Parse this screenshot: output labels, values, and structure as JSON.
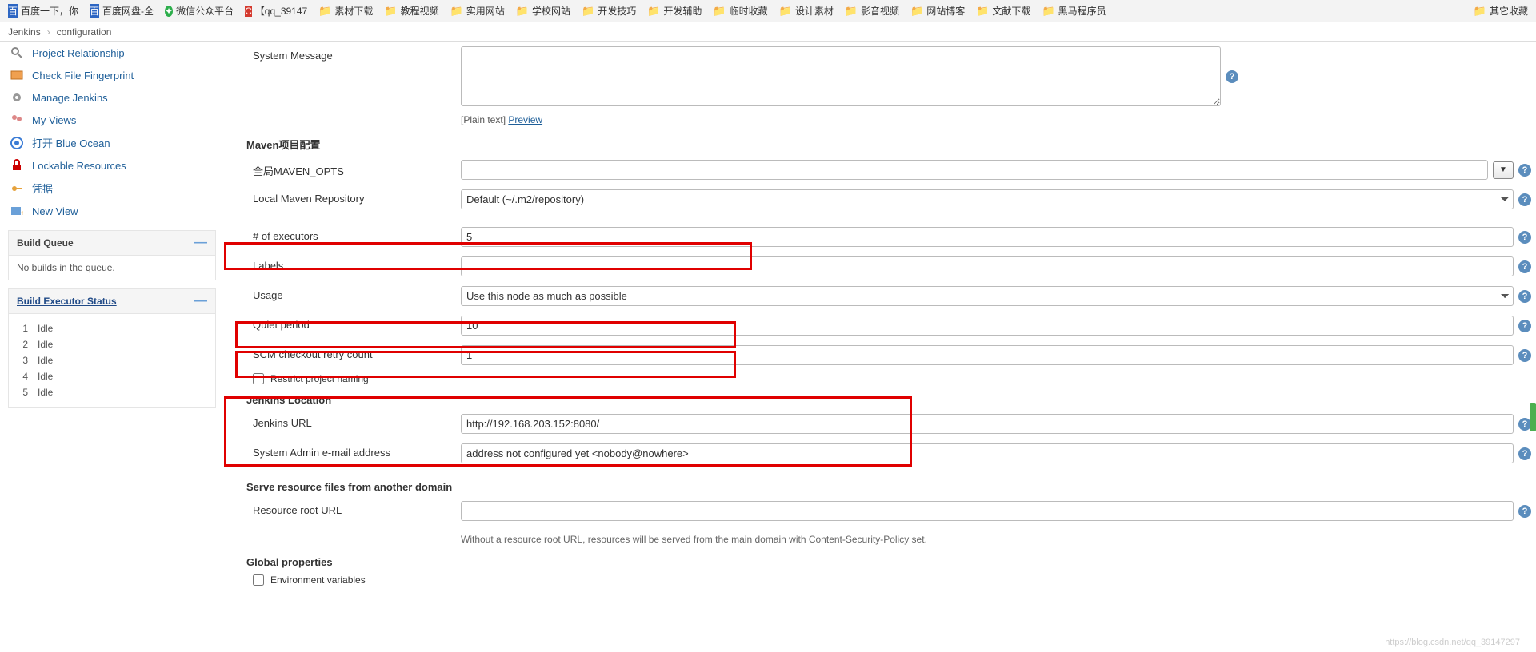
{
  "bookmarks": [
    {
      "icon": "baidu",
      "label": "百度一下，你",
      "color": "#2d66c3"
    },
    {
      "icon": "baidu",
      "label": "百度网盘-全",
      "color": "#2d66c3"
    },
    {
      "icon": "wechat",
      "label": "微信公众平台",
      "color": "#2cae4b"
    },
    {
      "icon": "csdn",
      "label": "【qq_39147",
      "color": "#d43a2f"
    },
    {
      "icon": "folder",
      "label": "素材下载"
    },
    {
      "icon": "folder",
      "label": "教程视频"
    },
    {
      "icon": "folder",
      "label": "实用网站"
    },
    {
      "icon": "folder",
      "label": "学校网站"
    },
    {
      "icon": "folder",
      "label": "开发技巧"
    },
    {
      "icon": "folder",
      "label": "开发辅助"
    },
    {
      "icon": "folder",
      "label": "临时收藏"
    },
    {
      "icon": "folder",
      "label": "设计素材"
    },
    {
      "icon": "folder",
      "label": "影音视频"
    },
    {
      "icon": "folder",
      "label": "网站博客"
    },
    {
      "icon": "folder",
      "label": "文献下载"
    },
    {
      "icon": "folder",
      "label": "黑马程序员"
    }
  ],
  "bookmarks_right": {
    "icon": "folder",
    "label": "其它收藏"
  },
  "breadcrumb": {
    "root": "Jenkins",
    "current": "configuration"
  },
  "sidebar": {
    "items": [
      {
        "label": "Project Relationship",
        "icon": "search"
      },
      {
        "label": "Check File Fingerprint",
        "icon": "fingerprint"
      },
      {
        "label": "Manage Jenkins",
        "icon": "gear"
      },
      {
        "label": "My Views",
        "icon": "people"
      },
      {
        "label": "打开 Blue Ocean",
        "icon": "blueocean"
      },
      {
        "label": "Lockable Resources",
        "icon": "lock"
      },
      {
        "label": "凭据",
        "icon": "key"
      },
      {
        "label": "New View",
        "icon": "plus"
      }
    ],
    "build_queue": {
      "title": "Build Queue",
      "empty": "No builds in the queue."
    },
    "executor": {
      "title": "Build Executor Status",
      "rows": [
        {
          "n": "1",
          "s": "Idle"
        },
        {
          "n": "2",
          "s": "Idle"
        },
        {
          "n": "3",
          "s": "Idle"
        },
        {
          "n": "4",
          "s": "Idle"
        },
        {
          "n": "5",
          "s": "Idle"
        }
      ]
    }
  },
  "form": {
    "system_message_label": "System Message",
    "plain_text": "[Plain text]",
    "preview": "Preview",
    "maven_section": "Maven项目配置",
    "maven_opts": "全局MAVEN_OPTS",
    "local_repo_label": "Local Maven Repository",
    "local_repo_value": "Default (~/.m2/repository)",
    "executors_label": "# of executors",
    "executors_value": "5",
    "labels_label": "Labels",
    "labels_value": "",
    "usage_label": "Usage",
    "usage_value": "Use this node as much as possible",
    "quiet_label": "Quiet period",
    "quiet_value": "10",
    "scm_label": "SCM checkout retry count",
    "scm_value": "1",
    "restrict_label": "Restrict project naming",
    "location_section": "Jenkins Location",
    "url_label": "Jenkins URL",
    "url_value": "http://192.168.203.152:8080/",
    "email_label": "System Admin e-mail address",
    "email_value": "address not configured yet <nobody@nowhere>",
    "serve_section": "Serve resource files from another domain",
    "resource_label": "Resource root URL",
    "resource_value": "",
    "resource_hint": "Without a resource root URL, resources will be served from the main domain with Content-Security-Policy set.",
    "global_section": "Global properties",
    "env_label": "Environment variables"
  },
  "watermark": "https://blog.csdn.net/qq_39147297"
}
